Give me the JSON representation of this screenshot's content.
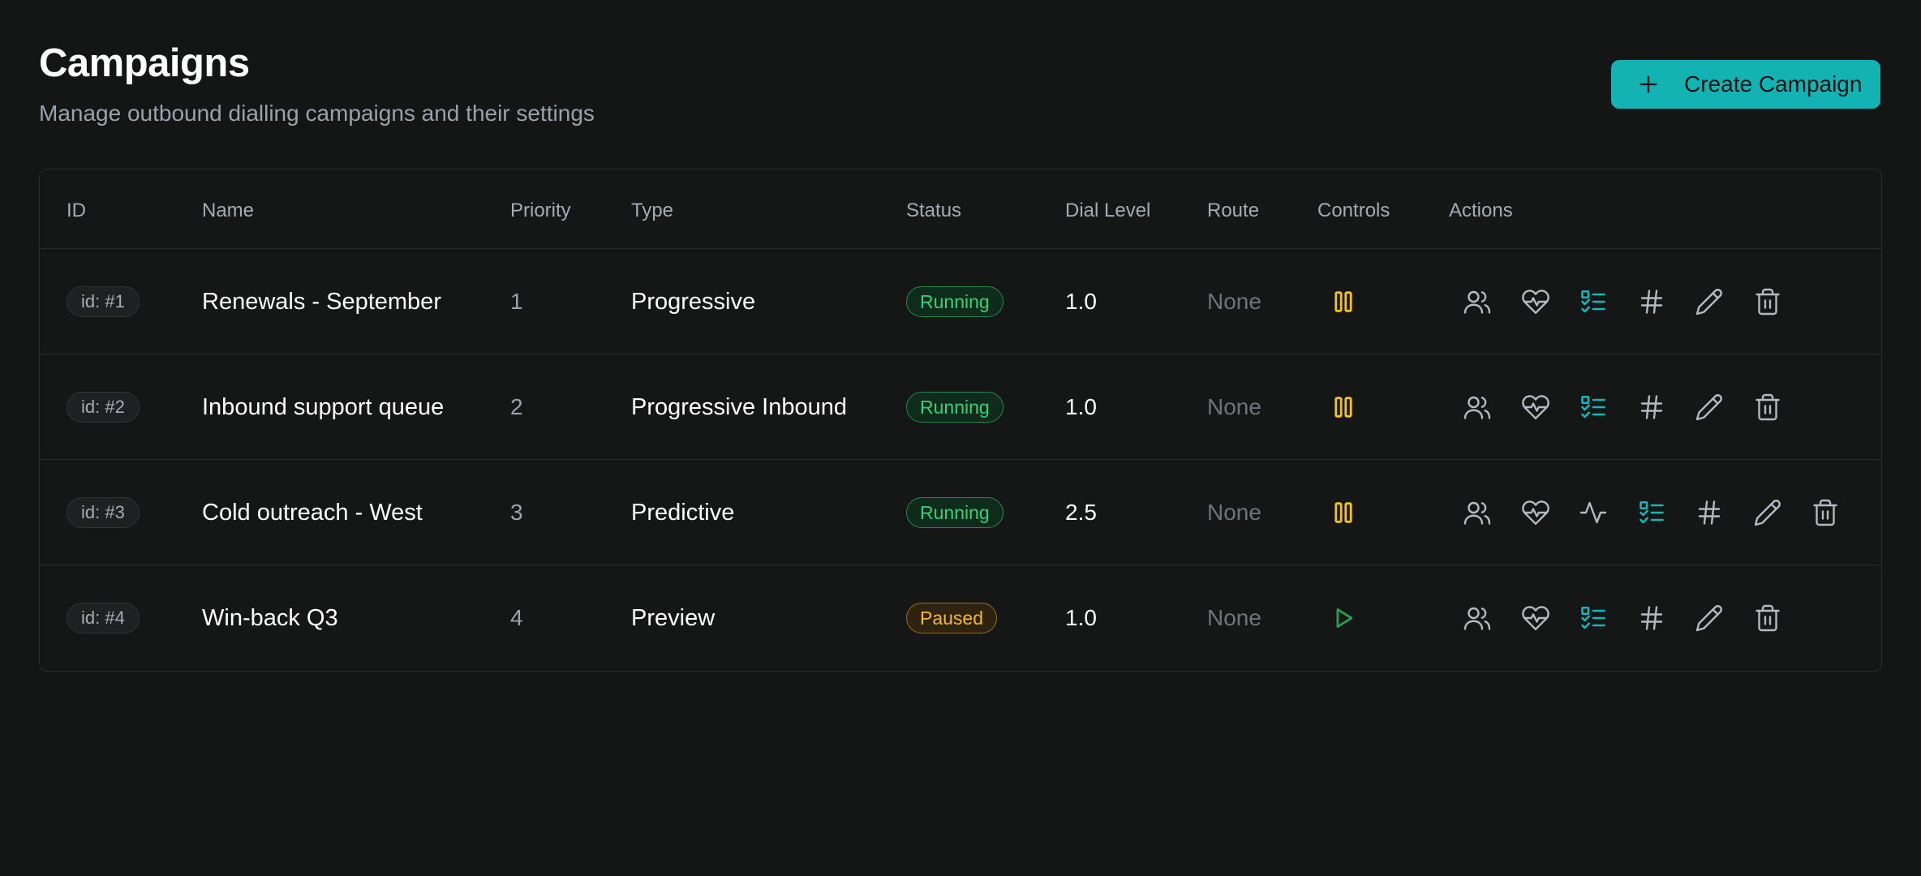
{
  "header": {
    "title": "Campaigns",
    "subtitle": "Manage outbound dialling campaigns and their settings",
    "create_button_label": "Create Campaign"
  },
  "table": {
    "columns": [
      "ID",
      "Name",
      "Priority",
      "Type",
      "Status",
      "Dial Level",
      "Route",
      "Controls",
      "Actions"
    ],
    "rows": [
      {
        "id_label": "id: #1",
        "name": "Renewals - September",
        "priority": "1",
        "type": "Progressive",
        "status": "Running",
        "dial_level": "1.0",
        "route": "None",
        "control": "pause-icon",
        "actions": [
          "users-icon",
          "heart-pulse-icon",
          "checklist-icon",
          "hash-icon",
          "pencil-icon",
          "trash-icon"
        ]
      },
      {
        "id_label": "id: #2",
        "name": "Inbound support queue",
        "priority": "2",
        "type": "Progressive Inbound",
        "status": "Running",
        "dial_level": "1.0",
        "route": "None",
        "control": "pause-icon",
        "actions": [
          "users-icon",
          "heart-pulse-icon",
          "checklist-icon",
          "hash-icon",
          "pencil-icon",
          "trash-icon"
        ]
      },
      {
        "id_label": "id: #3",
        "name": "Cold outreach - West",
        "priority": "3",
        "type": "Predictive",
        "status": "Running",
        "dial_level": "2.5",
        "route": "None",
        "control": "pause-icon",
        "actions": [
          "users-icon",
          "heart-pulse-icon",
          "activity-icon",
          "checklist-icon",
          "hash-icon",
          "pencil-icon",
          "trash-icon"
        ]
      },
      {
        "id_label": "id: #4",
        "name": "Win-back Q3",
        "priority": "4",
        "type": "Preview",
        "status": "Paused",
        "dial_level": "1.0",
        "route": "None",
        "control": "play-icon",
        "actions": [
          "users-icon",
          "heart-pulse-icon",
          "checklist-icon",
          "hash-icon",
          "pencil-icon",
          "trash-icon"
        ]
      }
    ]
  },
  "colors": {
    "background": "#141515",
    "accent": "#14b3b3",
    "running": "#33d17a",
    "paused": "#f5b82a",
    "pause_icon": "#f5c21b",
    "play_icon": "#22a04d",
    "icon_gray": "#b4bac2",
    "icon_teal": "#14b8b8"
  }
}
